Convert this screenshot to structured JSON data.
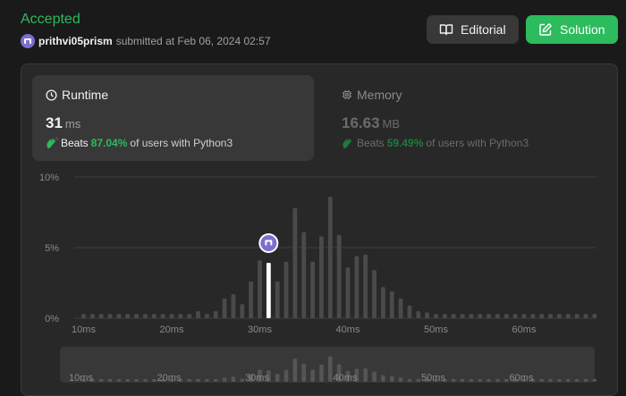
{
  "submission": {
    "status": "Accepted",
    "username": "prithvi05prism",
    "submitted_text": "submitted at Feb 06, 2024 02:57"
  },
  "buttons": {
    "editorial_label": "Editorial",
    "solution_label": "Solution"
  },
  "runtime": {
    "title": "Runtime",
    "value": "31",
    "unit": "ms",
    "beats_label": "Beats",
    "beats_pct": "87.04%",
    "beats_suffix": "of users with Python3"
  },
  "memory": {
    "title": "Memory",
    "value": "16.63",
    "unit": "MB",
    "beats_label": "Beats",
    "beats_pct": "59.49%",
    "beats_suffix": "of users with Python3"
  },
  "colors": {
    "accepted": "#2cbb5d",
    "bar": "#4a4a4a",
    "highlight_bar": "#ffffff",
    "marker": "#7b6fd0"
  },
  "icons": [
    "book-icon",
    "edit-icon",
    "clock-icon",
    "chip-icon",
    "clap-icon"
  ],
  "chart_data": {
    "type": "bar",
    "ylabel_ticks": [
      "10%",
      "5%",
      "0%"
    ],
    "ylim": [
      0,
      10
    ],
    "xtick_labels": [
      "10ms",
      "20ms",
      "30ms",
      "40ms",
      "50ms",
      "60ms"
    ],
    "xtick_values": [
      10,
      20,
      30,
      40,
      50,
      60
    ],
    "x": [
      10,
      11,
      12,
      13,
      14,
      15,
      16,
      17,
      18,
      19,
      20,
      21,
      22,
      23,
      24,
      25,
      26,
      27,
      28,
      29,
      30,
      31,
      32,
      33,
      34,
      35,
      36,
      37,
      38,
      39,
      40,
      41,
      42,
      43,
      44,
      45,
      46,
      47,
      48,
      49,
      50,
      51,
      52,
      53,
      54,
      55,
      56,
      57,
      58,
      59,
      60,
      61,
      62,
      63,
      64,
      65,
      66,
      67,
      68,
      69,
      70
    ],
    "values": [
      0.3,
      0.3,
      0.3,
      0.3,
      0.3,
      0.3,
      0.3,
      0.3,
      0.3,
      0.3,
      0.3,
      0.3,
      0.3,
      0.5,
      0.3,
      0.5,
      1.4,
      1.7,
      1.0,
      2.6,
      4.1,
      3.8,
      2.6,
      4.0,
      7.8,
      6.1,
      4.0,
      5.8,
      8.6,
      5.9,
      3.6,
      4.4,
      4.5,
      3.4,
      2.2,
      1.9,
      1.4,
      0.9,
      0.5,
      0.4,
      0.3,
      0.3,
      0.3,
      0.3,
      0.3,
      0.3,
      0.3,
      0.3,
      0.3,
      0.3,
      0.3,
      0.3,
      0.3,
      0.3,
      0.3,
      0.3,
      0.3,
      0.3,
      0.3
    ],
    "highlight_x": 31,
    "grid": true
  }
}
